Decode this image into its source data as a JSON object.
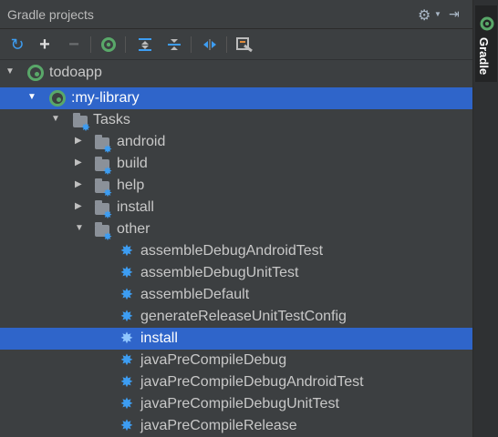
{
  "panel": {
    "title": "Gradle projects"
  },
  "sidebar": {
    "tab_label": "Gradle"
  },
  "toolbar": {
    "icons": [
      "refresh-icon",
      "add-icon",
      "remove-icon",
      "gradle-icon",
      "expand-all-icon",
      "collapse-all-icon",
      "link-icon",
      "settings-icon"
    ]
  },
  "tree": {
    "root": "todoapp",
    "module": ":my-library",
    "tasks": "Tasks",
    "groups": [
      "android",
      "build",
      "help",
      "install",
      "other"
    ],
    "tasks_other": [
      "assembleDebugAndroidTest",
      "assembleDebugUnitTest",
      "assembleDefault",
      "generateReleaseUnitTestConfig",
      "install",
      "javaPreCompileDebug",
      "javaPreCompileDebugAndroidTest",
      "javaPreCompileDebugUnitTest",
      "javaPreCompileRelease"
    ]
  },
  "colors": {
    "selection": "#2f65ca",
    "gradle_green": "#59a869",
    "gear_blue": "#3d9df2"
  }
}
